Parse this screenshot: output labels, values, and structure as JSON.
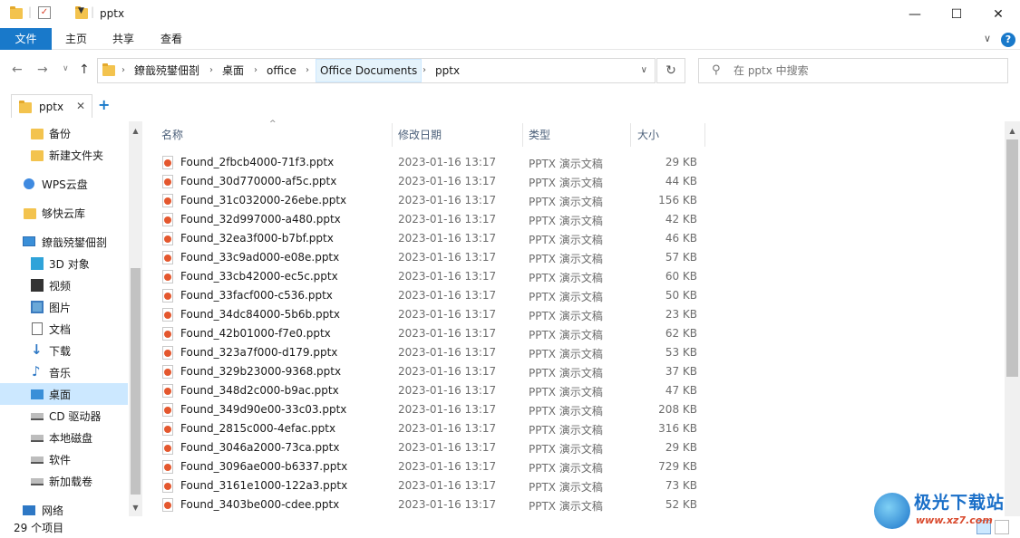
{
  "window": {
    "title": "pptx",
    "controls": {
      "minimize": "—",
      "maximize": "☐",
      "close": "✕"
    }
  },
  "ribbon": {
    "tabs": [
      "文件",
      "主页",
      "共享",
      "查看"
    ],
    "help": "?"
  },
  "address": {
    "crumbs": [
      "鐐戠殑鐢佃剳",
      "桌面",
      "office",
      "Office Documents",
      "pptx"
    ],
    "search_placeholder": "在 pptx 中搜索"
  },
  "tab": {
    "label": "pptx",
    "close": "✕",
    "add": "+"
  },
  "nav": {
    "items": [
      {
        "label": "备份",
        "icon": "folder-icon"
      },
      {
        "label": "新建文件夹",
        "icon": "folder-icon"
      },
      {
        "label": "WPS云盘",
        "icon": "cloud-icon"
      },
      {
        "label": "够快云库",
        "icon": "folder-icon"
      },
      {
        "label": "鐐戠殑鐢佃剳",
        "icon": "computer-icon"
      },
      {
        "label": "3D 对象",
        "icon": "cube-icon"
      },
      {
        "label": "视频",
        "icon": "video-icon"
      },
      {
        "label": "图片",
        "icon": "picture-icon"
      },
      {
        "label": "文档",
        "icon": "document-icon"
      },
      {
        "label": "下载",
        "icon": "download-icon"
      },
      {
        "label": "音乐",
        "icon": "music-icon"
      },
      {
        "label": "桌面",
        "icon": "desktop-icon",
        "selected": true
      },
      {
        "label": "CD 驱动器",
        "icon": "cd-drive-icon"
      },
      {
        "label": "本地磁盘",
        "icon": "disk-icon"
      },
      {
        "label": "软件",
        "icon": "disk-icon"
      },
      {
        "label": "新加载卷",
        "icon": "disk-icon"
      },
      {
        "label": "网络",
        "icon": "network-icon"
      }
    ]
  },
  "columns": {
    "name": "名称",
    "date": "修改日期",
    "type": "类型",
    "size": "大小"
  },
  "files": [
    {
      "name": "Found_2fbcb4000-71f3.pptx",
      "date": "2023-01-16 13:17",
      "type": "PPTX 演示文稿",
      "size": "29 KB"
    },
    {
      "name": "Found_30d770000-af5c.pptx",
      "date": "2023-01-16 13:17",
      "type": "PPTX 演示文稿",
      "size": "44 KB"
    },
    {
      "name": "Found_31c032000-26ebe.pptx",
      "date": "2023-01-16 13:17",
      "type": "PPTX 演示文稿",
      "size": "156 KB"
    },
    {
      "name": "Found_32d997000-a480.pptx",
      "date": "2023-01-16 13:17",
      "type": "PPTX 演示文稿",
      "size": "42 KB"
    },
    {
      "name": "Found_32ea3f000-b7bf.pptx",
      "date": "2023-01-16 13:17",
      "type": "PPTX 演示文稿",
      "size": "46 KB"
    },
    {
      "name": "Found_33c9ad000-e08e.pptx",
      "date": "2023-01-16 13:17",
      "type": "PPTX 演示文稿",
      "size": "57 KB"
    },
    {
      "name": "Found_33cb42000-ec5c.pptx",
      "date": "2023-01-16 13:17",
      "type": "PPTX 演示文稿",
      "size": "60 KB"
    },
    {
      "name": "Found_33facf000-c536.pptx",
      "date": "2023-01-16 13:17",
      "type": "PPTX 演示文稿",
      "size": "50 KB"
    },
    {
      "name": "Found_34dc84000-5b6b.pptx",
      "date": "2023-01-16 13:17",
      "type": "PPTX 演示文稿",
      "size": "23 KB"
    },
    {
      "name": "Found_42b01000-f7e0.pptx",
      "date": "2023-01-16 13:17",
      "type": "PPTX 演示文稿",
      "size": "62 KB"
    },
    {
      "name": "Found_323a7f000-d179.pptx",
      "date": "2023-01-16 13:17",
      "type": "PPTX 演示文稿",
      "size": "53 KB"
    },
    {
      "name": "Found_329b23000-9368.pptx",
      "date": "2023-01-16 13:17",
      "type": "PPTX 演示文稿",
      "size": "37 KB"
    },
    {
      "name": "Found_348d2c000-b9ac.pptx",
      "date": "2023-01-16 13:17",
      "type": "PPTX 演示文稿",
      "size": "47 KB"
    },
    {
      "name": "Found_349d90e00-33c03.pptx",
      "date": "2023-01-16 13:17",
      "type": "PPTX 演示文稿",
      "size": "208 KB"
    },
    {
      "name": "Found_2815c000-4efac.pptx",
      "date": "2023-01-16 13:17",
      "type": "PPTX 演示文稿",
      "size": "316 KB"
    },
    {
      "name": "Found_3046a2000-73ca.pptx",
      "date": "2023-01-16 13:17",
      "type": "PPTX 演示文稿",
      "size": "29 KB"
    },
    {
      "name": "Found_3096ae000-b6337.pptx",
      "date": "2023-01-16 13:17",
      "type": "PPTX 演示文稿",
      "size": "729 KB"
    },
    {
      "name": "Found_3161e1000-122a3.pptx",
      "date": "2023-01-16 13:17",
      "type": "PPTX 演示文稿",
      "size": "73 KB"
    },
    {
      "name": "Found_3403be000-cdee.pptx",
      "date": "2023-01-16 13:17",
      "type": "PPTX 演示文稿",
      "size": "52 KB"
    }
  ],
  "status": {
    "count": "29 个项目"
  },
  "watermark": {
    "title": "极光下载站",
    "url": "www.xz7.com"
  },
  "colors": {
    "accent": "#1979ca",
    "selection": "#cce8ff",
    "folder": "#f3c34e"
  }
}
